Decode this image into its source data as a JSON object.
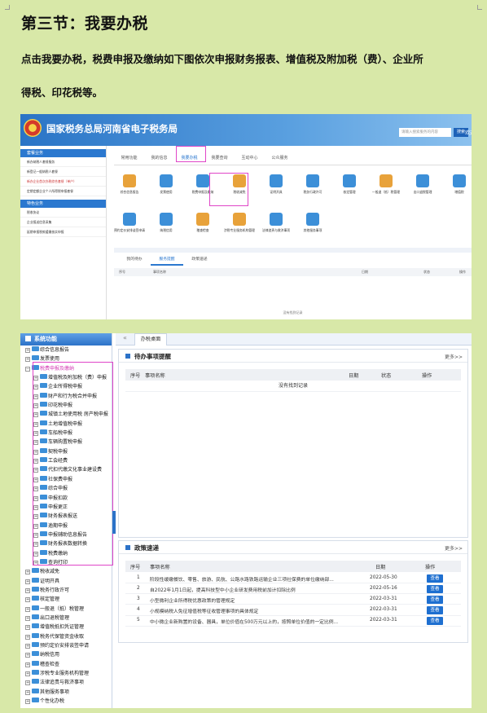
{
  "heading": "第三节：我要办税",
  "intro_line1": "点击我要办税，税费申报及缴纳如下图依次申报财务报表、增值税及附加税（费）、企业所",
  "intro_line2": "得税、印花税等。",
  "screenshot1": {
    "title": "国家税务总局河南省电子税务局",
    "search_placeholder": "请输入搜索服务的内容",
    "search_button": "搜索",
    "welcome": "欢迎",
    "left_menu": {
      "group1": "套餐业务",
      "items1": [
        "新办纳税人套餐服务",
        "新登记一般纳税人套餐",
        "新办企业首次办税综合套餐（单户）",
        "定期定额企业个人所得税申报套餐"
      ],
      "group2": "特色业务",
      "items2": [
        "税收协议",
        "企业报送信息采集",
        "延期申报税款缓缴核实申报"
      ]
    },
    "tabs": [
      "常用功能",
      "我的信息",
      "我要办税",
      "我要查询",
      "互动中心",
      "公众服务"
    ],
    "icons": [
      {
        "label": "综合信息报告",
        "color": "#e8a23a"
      },
      {
        "label": "发票使用",
        "color": "#3c8fd8"
      },
      {
        "label": "税费申报及缴纳",
        "color": "#3c8fd8"
      },
      {
        "label": "税收减免",
        "color": "#e8a23a"
      },
      {
        "label": "证明开具",
        "color": "#3c8fd8"
      },
      {
        "label": "税务行政许可",
        "color": "#3c8fd8"
      },
      {
        "label": "核定管理",
        "color": "#3c8fd8"
      },
      {
        "label": "一般退（抵）税管理",
        "color": "#e8a23a"
      },
      {
        "label": "出口退税管理",
        "color": "#3c8fd8"
      },
      {
        "label": "增值税",
        "color": "#3c8fd8"
      },
      {
        "label": "预约定价安排谈签申请",
        "color": "#3c8fd8"
      },
      {
        "label": "纳税信用",
        "color": "#3c8fd8"
      },
      {
        "label": "稽查检查",
        "color": "#e8a23a"
      },
      {
        "label": "涉税专业服务机构管理",
        "color": "#e8a23a"
      },
      {
        "label": "法律追责与救济事项",
        "color": "#3c8fd8"
      },
      {
        "label": "其他服务事项",
        "color": "#3c8fd8"
      }
    ],
    "panel_tabs": [
      "我的待办",
      "服务提醒",
      "政策速递"
    ],
    "table_headers": [
      "序号",
      "事项名称",
      "日期",
      "状态",
      "操作"
    ],
    "no_records": "没有找到记录"
  },
  "screenshot2": {
    "left_title": "系统功能",
    "tree": [
      {
        "label": "综合信息报告",
        "level": 0,
        "expanded": false
      },
      {
        "label": "发票使用",
        "level": 0,
        "expanded": false
      },
      {
        "label": "税费申报及缴纳",
        "level": 0,
        "expanded": true
      },
      {
        "label": "增值税及附加税（费）申报",
        "level": 1
      },
      {
        "label": "企业所得税申报",
        "level": 1
      },
      {
        "label": "财产和行为税合并申报",
        "level": 1
      },
      {
        "label": "印花税申报",
        "level": 1
      },
      {
        "label": "城镇土地使用税 房产税申报",
        "level": 1
      },
      {
        "label": "土地增值税申报",
        "level": 1
      },
      {
        "label": "车船税申报",
        "level": 1
      },
      {
        "label": "车辆购置税申报",
        "level": 1
      },
      {
        "label": "契税申报",
        "level": 1
      },
      {
        "label": "工会经费",
        "level": 1
      },
      {
        "label": "代扣代缴文化事业建设费",
        "level": 1
      },
      {
        "label": "社保费申报",
        "level": 1
      },
      {
        "label": "综合申报",
        "level": 1
      },
      {
        "label": "申报扣款",
        "level": 1
      },
      {
        "label": "申报更正",
        "level": 1
      },
      {
        "label": "财务报表报送",
        "level": 1
      },
      {
        "label": "逾期申报",
        "level": 1
      },
      {
        "label": "申报辅助信息报告",
        "level": 1
      },
      {
        "label": "财务报表数据转换",
        "level": 1
      },
      {
        "label": "税费缴纳",
        "level": 1
      },
      {
        "label": "查询打印",
        "level": 1
      },
      {
        "label": "税收减免",
        "level": 0,
        "expanded": false
      },
      {
        "label": "证明开具",
        "level": 0,
        "expanded": false
      },
      {
        "label": "税务行政许可",
        "level": 0,
        "expanded": false
      },
      {
        "label": "核定管理",
        "level": 0,
        "expanded": false
      },
      {
        "label": "一般退（抵）税管理",
        "level": 0,
        "expanded": false
      },
      {
        "label": "出口退税管理",
        "level": 0,
        "expanded": false
      },
      {
        "label": "增值税抵扣凭证管理",
        "level": 0,
        "expanded": false
      },
      {
        "label": "税务代保管资金收取",
        "level": 0,
        "expanded": false
      },
      {
        "label": "预约定价安排谈签申请",
        "level": 0,
        "expanded": false
      },
      {
        "label": "纳税信用",
        "level": 0,
        "expanded": false
      },
      {
        "label": "稽查检查",
        "level": 0,
        "expanded": false
      },
      {
        "label": "涉税专业服务机构管理",
        "level": 0,
        "expanded": false
      },
      {
        "label": "法律追责与救济事项",
        "level": 0,
        "expanded": false
      },
      {
        "label": "其他服务事项",
        "level": 0,
        "expanded": false
      },
      {
        "label": "个性化办税",
        "level": 0,
        "expanded": false
      }
    ],
    "top_tab": "办税桌面",
    "todo_panel": {
      "title": "待办事项提醒",
      "more": "更多>>",
      "headers": [
        "序号",
        "事项名称",
        "日期",
        "状态",
        "操作"
      ],
      "empty": "没有找到记录"
    },
    "policy_panel": {
      "title": "政策速递",
      "more": "更多>>",
      "headers": [
        "序号",
        "事项名称",
        "日期",
        "操作"
      ],
      "rows": [
        {
          "no": "1",
          "name": "阶段性缓缴餐饮、零售、旅游、民航、公路水路铁路运输企业三项社保费的单位缴纳部...",
          "date": "2022-05-30",
          "action": "查看"
        },
        {
          "no": "2",
          "name": "自2022年1月1日起，提高科技型中小企业研发费用税前加计扣除比例",
          "date": "2022-05-16",
          "action": "查看"
        },
        {
          "no": "3",
          "name": "小型微利企业所得税优惠政策的管理规定",
          "date": "2022-03-31",
          "action": "查看"
        },
        {
          "no": "4",
          "name": "小规模纳税人免征增值税等征收管理事项的具体规定",
          "date": "2022-03-31",
          "action": "查看"
        },
        {
          "no": "5",
          "name": "中小微企业新购置的设备、器具，单位价值在500万元以上的，按照单位价值的一定比例...",
          "date": "2022-03-31",
          "action": "查看"
        }
      ]
    }
  },
  "colors": {
    "page_bg": "#d8e8a8",
    "highlight": "#e046c8",
    "primary_blue": "#2b78cf"
  }
}
